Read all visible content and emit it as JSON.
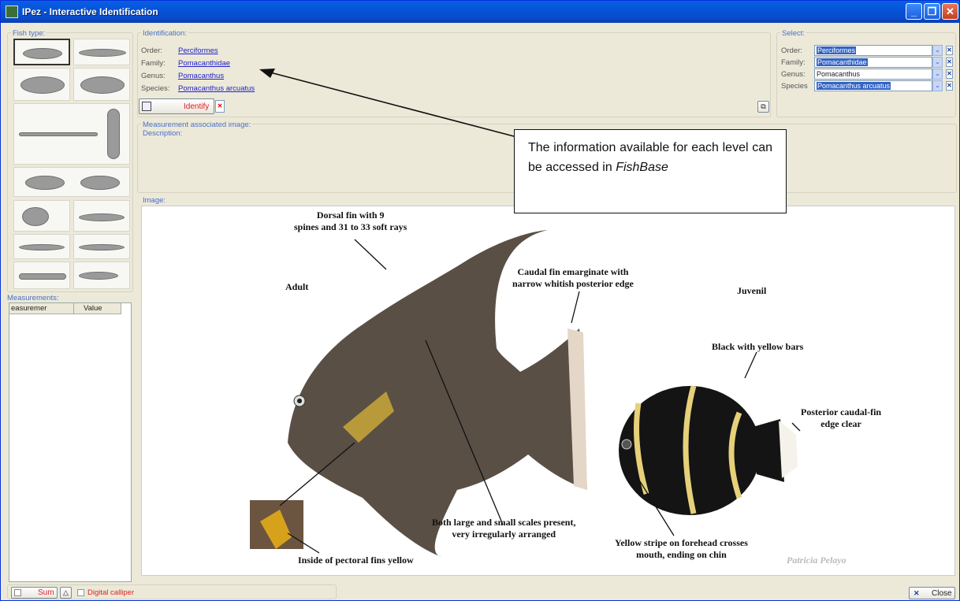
{
  "window": {
    "title": "IPez - Interactive Identification"
  },
  "fish_type": {
    "label": "Fish type:"
  },
  "identification": {
    "label": "Identification:",
    "rows": [
      {
        "label": "Order:",
        "value": "Perciformes"
      },
      {
        "label": "Family:",
        "value": "Pomacanthidae"
      },
      {
        "label": "Genus:",
        "value": "Pomacanthus"
      },
      {
        "label": "Species:",
        "value": "Pomacanthus arcuatus"
      }
    ],
    "identify_label": "Identify"
  },
  "select": {
    "label": "Select:",
    "rows": [
      {
        "label": "Order:",
        "value": "Perciformes",
        "highlighted": true
      },
      {
        "label": "Family:",
        "value": "Pomacanthidae",
        "highlighted": true
      },
      {
        "label": "Genus:",
        "value": "Pomacanthus",
        "highlighted": false
      },
      {
        "label": "Species",
        "value": "Pomacanthus arcuatus",
        "highlighted": true
      }
    ]
  },
  "measurement_image": {
    "label": "Measurement associated image:",
    "description_label": "Description:"
  },
  "image": {
    "label": "Image:",
    "annotations": {
      "dorsal": "Dorsal fin with 9\nspines and 31 to 33 soft rays",
      "adult": "Adult",
      "caudal": "Caudal fin emarginate with\nnarrow whitish posterior edge",
      "juvenil": "Juvenil",
      "black_bars": "Black with yellow bars",
      "posterior": "Posterior caudal-fin\nedge clear",
      "scales": "Both large and small scales present,\nvery irregularly arranged",
      "yellow_stripe": "Yellow stripe on forehead crosses\nmouth, ending on chin",
      "pectoral": "Inside of pectoral fins yellow",
      "credit": "Patricia Pelayo"
    }
  },
  "callout": {
    "text": "The information available for each level can be accessed in",
    "emph": "FishBase"
  },
  "measurements": {
    "label": "Measurements:",
    "col1": "easuremer",
    "col2": "Value"
  },
  "footer": {
    "sum_label": "Sum",
    "calliper_label": "Digital calliper",
    "close_label": "Close"
  },
  "colors": {
    "titlebar": "#0A5FE6",
    "accent": "#4a6fc7",
    "link": "#2323c8",
    "selection": "#3163c5"
  }
}
